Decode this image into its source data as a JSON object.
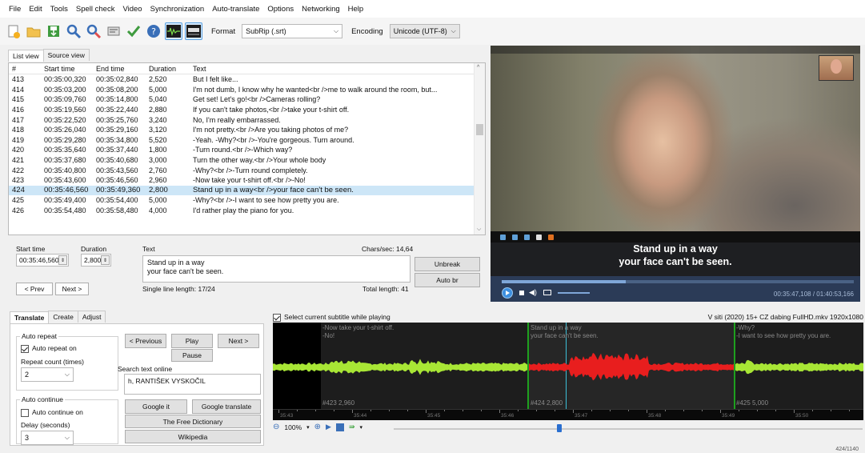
{
  "menu": [
    "File",
    "Edit",
    "Tools",
    "Spell check",
    "Video",
    "Synchronization",
    "Auto-translate",
    "Options",
    "Networking",
    "Help"
  ],
  "toolbar": {
    "format_label": "Format",
    "format_value": "SubRip (.srt)",
    "encoding_label": "Encoding",
    "encoding_value": "Unicode (UTF-8)"
  },
  "tabs": {
    "list_view": "List view",
    "source_view": "Source view"
  },
  "list": {
    "headers": [
      "#",
      "Start time",
      "End time",
      "Duration",
      "Text"
    ],
    "rows": [
      [
        "413",
        "00:35:00,320",
        "00:35:02,840",
        "2,520",
        "But I felt like..."
      ],
      [
        "414",
        "00:35:03,200",
        "00:35:08,200",
        "5,000",
        "I'm not dumb, I know why he wanted<br />me to walk around the room, but..."
      ],
      [
        "415",
        "00:35:09,760",
        "00:35:14,800",
        "5,040",
        "Get set! Let's go!<br />Cameras rolling?"
      ],
      [
        "416",
        "00:35:19,560",
        "00:35:22,440",
        "2,880",
        "If you can't take photos,<br />take your t-shirt off."
      ],
      [
        "417",
        "00:35:22,520",
        "00:35:25,760",
        "3,240",
        "No, I'm really embarrassed."
      ],
      [
        "418",
        "00:35:26,040",
        "00:35:29,160",
        "3,120",
        "I'm not pretty.<br />Are you taking photos of me?"
      ],
      [
        "419",
        "00:35:29,280",
        "00:35:34,800",
        "5,520",
        "-Yeah. -Why?<br />-You're gorgeous. Turn around."
      ],
      [
        "420",
        "00:35:35,640",
        "00:35:37,440",
        "1,800",
        "-Turn round.<br />-Which way?"
      ],
      [
        "421",
        "00:35:37,680",
        "00:35:40,680",
        "3,000",
        "Turn the other way.<br />Your whole body"
      ],
      [
        "422",
        "00:35:40,800",
        "00:35:43,560",
        "2,760",
        "-Why?<br />-Turn round completely."
      ],
      [
        "423",
        "00:35:43,600",
        "00:35:46,560",
        "2,960",
        "-Now take your t-shirt off.<br />-No!"
      ],
      [
        "424",
        "00:35:46,560",
        "00:35:49,360",
        "2,800",
        "Stand up in a way<br />your face can't be seen."
      ],
      [
        "425",
        "00:35:49,400",
        "00:35:54,400",
        "5,000",
        "-Why?<br />-I want to see how pretty you are."
      ],
      [
        "426",
        "00:35:54,480",
        "00:35:58,480",
        "4,000",
        "I'd rather play the piano for you."
      ]
    ],
    "selected_index": 11
  },
  "editor": {
    "start_time_label": "Start time",
    "duration_label": "Duration",
    "text_label": "Text",
    "chars_sec": "Chars/sec: 14,64",
    "start_time": "00:35:46,560",
    "duration": "2,800",
    "text_line1": "Stand up in a way",
    "text_line2": "your face can't be seen.",
    "single_line_length": "Single line length: 17/24",
    "total_length": "Total length: 41",
    "unbreak": "Unbreak",
    "auto_br": "Auto br",
    "prev": "< Prev",
    "next": "Next >"
  },
  "video": {
    "subtitle_line1": "Stand up in a way",
    "subtitle_line2": "your face can't be seen.",
    "time": "00:35:47,108 / 01:40:53,166",
    "progress": 0.352
  },
  "bottom_tabs": {
    "translate": "Translate",
    "create": "Create",
    "adjust": "Adjust"
  },
  "translate": {
    "auto_repeat_group": "Auto repeat",
    "auto_repeat_on": "Auto repeat on",
    "repeat_count_label": "Repeat count (times)",
    "repeat_count": "2",
    "auto_continue_group": "Auto continue",
    "auto_continue_on": "Auto continue on",
    "delay_label": "Delay (seconds)",
    "delay": "3",
    "previous": "< Previous",
    "play": "Play",
    "next": "Next >",
    "pause": "Pause",
    "search_online_label": "Search text online",
    "search_text": "h, RANTIŠEK VYSKOČIL",
    "google_it": "Google it",
    "google_translate": "Google translate",
    "free_dictionary": "The Free Dictionary",
    "wikipedia": "Wikipedia"
  },
  "waveform": {
    "select_current": "Select current subtitle while playing",
    "file_info": "V siti (2020) 15+ CZ dabing FullHD.mkv 1920x1080",
    "seg_a_line1": "-Now take your t-shirt off.",
    "seg_a_line2": "-No!",
    "seg_b_line1": "Stand up in a way",
    "seg_b_line2": "your face can't be seen.",
    "seg_c_line1": "-Why?",
    "seg_c_line2": "-I want to see how pretty you are.",
    "seg_a_info": "#423  2,960",
    "seg_b_info": "#424  2,800",
    "seg_c_info": "#425  5,000",
    "ticks": [
      "35:43",
      "35:44",
      "35:45",
      "35:46",
      "35:47",
      "35:48",
      "35:49",
      "35:50",
      "35:51"
    ],
    "zoom": "100%"
  },
  "status": "424/1140",
  "colors": {
    "accent": "#3d8fe0",
    "wave_green": "#a8e635",
    "wave_red": "#e81e1e",
    "selected_row": "#cde6f7"
  }
}
